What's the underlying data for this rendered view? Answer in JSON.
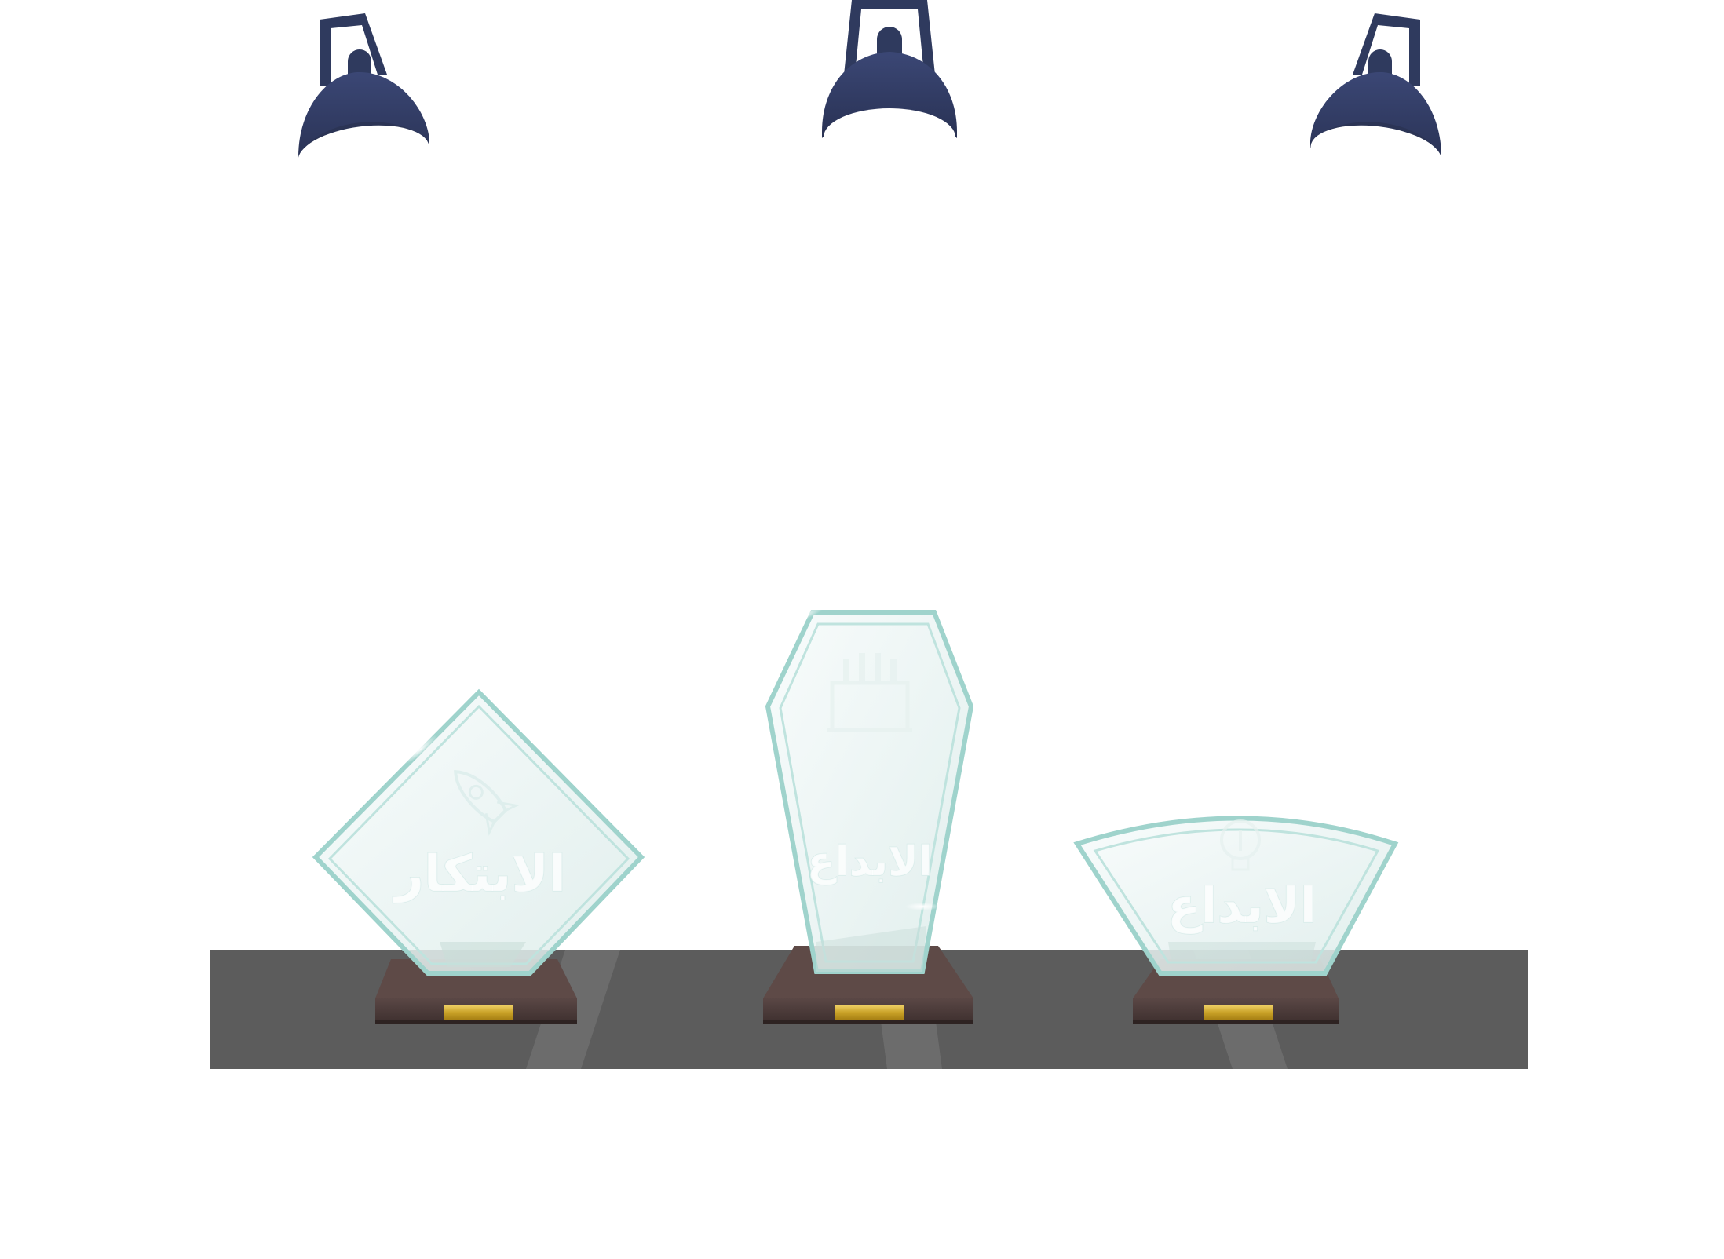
{
  "colors": {
    "background": "#ffffff",
    "lamp": "#2f3a5e",
    "lamp_shade": "#36416a",
    "shelf": "#5c5c5c",
    "base_wood": "#4a3a38",
    "base_top": "#5e4a47",
    "plaque_gold": "#c9a227",
    "glass_edge": "#9fd3cc",
    "glass_fill": "#e9f3f2"
  },
  "lamps": [
    {
      "name": "lamp-left",
      "icon": "spotlight-icon"
    },
    {
      "name": "lamp-center",
      "icon": "spotlight-icon"
    },
    {
      "name": "lamp-right",
      "icon": "spotlight-icon"
    }
  ],
  "trophies": [
    {
      "shape": "diamond",
      "engraving": "الابتكار",
      "emblem": "rocket-icon"
    },
    {
      "shape": "tall-hexagon",
      "engraving": "الابداع",
      "emblem": "fist-icon"
    },
    {
      "shape": "fan",
      "engraving": "الابداع",
      "emblem": "lightbulb-icon"
    }
  ]
}
